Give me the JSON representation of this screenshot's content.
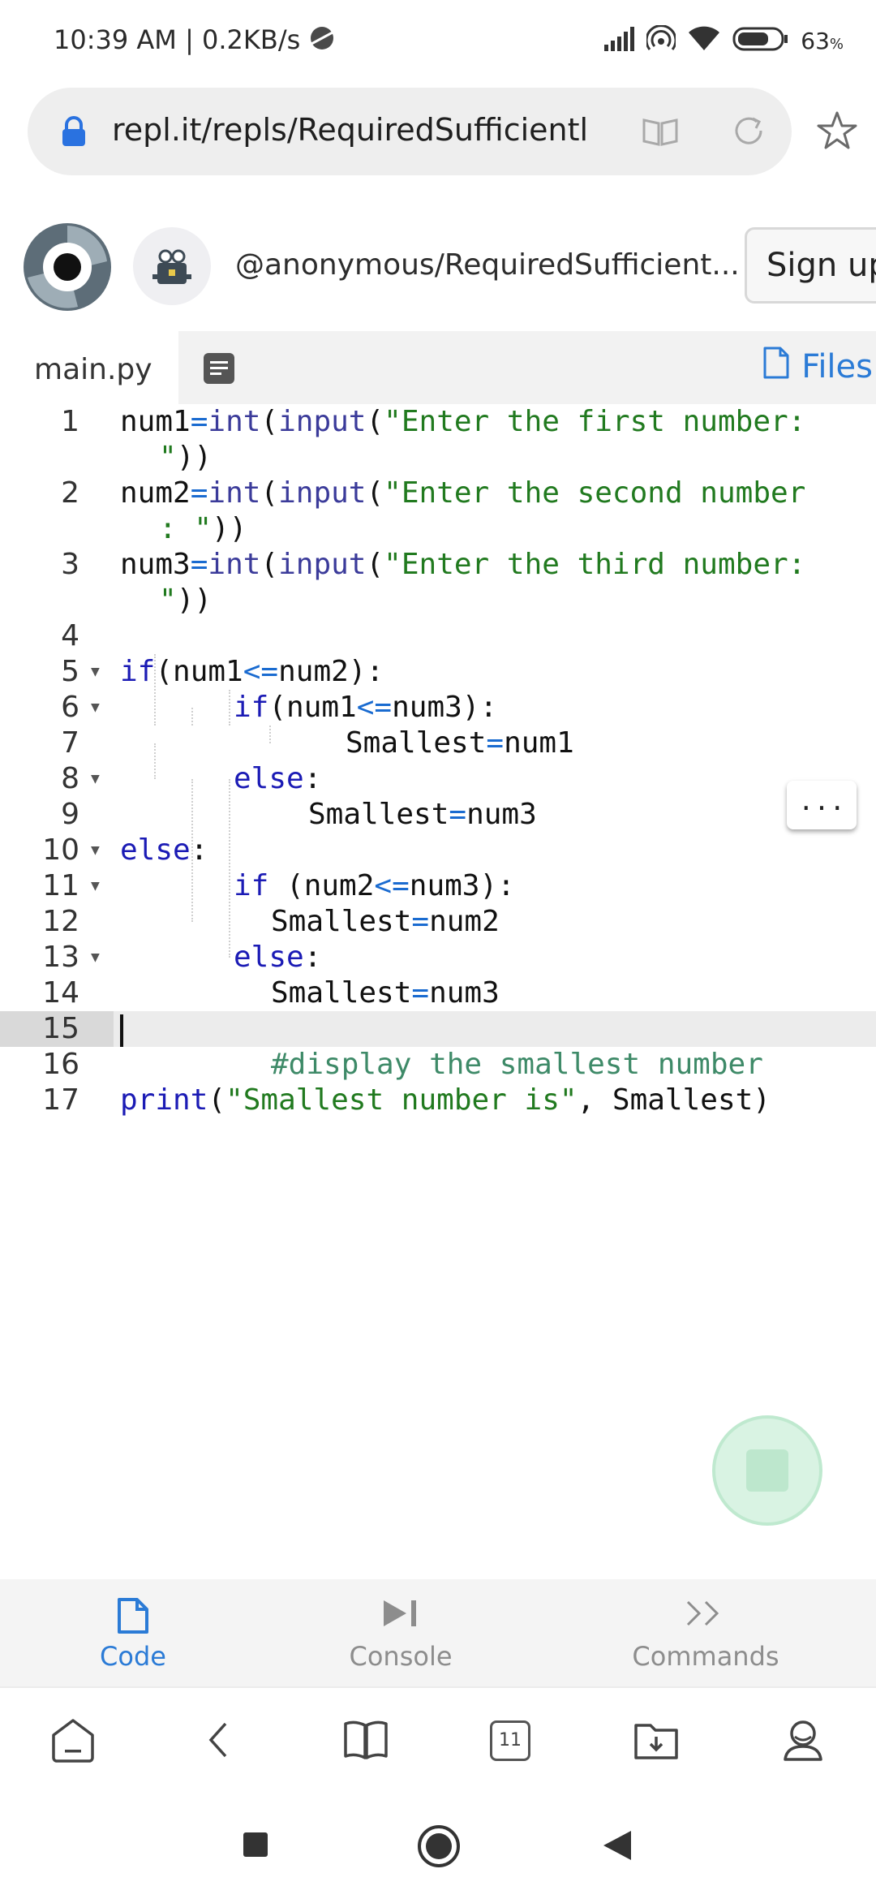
{
  "status": {
    "time_speed": "10:39 AM | 0.2KB/s",
    "battery": "63"
  },
  "browser": {
    "url": "repl.it/repls/RequiredSufficientl",
    "tabs_count": "11"
  },
  "repl": {
    "owner_name": "@anonymous/RequiredSufficient...",
    "signup_label": "Sign up",
    "file_tab": "main.py",
    "files_label": "Files",
    "more_label": "...",
    "active_line": "15"
  },
  "code": {
    "lines": [
      {
        "num": "1",
        "a": "num1",
        "b": "=",
        "c": "int",
        "d": "(",
        "e": "input",
        "f": "(",
        "g": "\"Enter the first number:",
        "cont": "\"))"
      },
      {
        "num": "2",
        "a": "num2",
        "b": "=",
        "c": "int",
        "d": "(",
        "e": "input",
        "f": "(",
        "g": "\"Enter the second number",
        "cont": ": \"))"
      },
      {
        "num": "3",
        "a": "num3",
        "b": "=",
        "c": "int",
        "d": "(",
        "e": "input",
        "f": "(",
        "g": "\"Enter the third number:",
        "cont": "\"))"
      },
      {
        "num": "4"
      },
      {
        "num": "5",
        "kw": "if",
        "rest1": "(num1",
        "op": "<=",
        "rest2": "num2):"
      },
      {
        "num": "6",
        "kw": "if",
        "rest1": "(num1",
        "op": "<=",
        "rest2": "num3):"
      },
      {
        "num": "7",
        "a": "Smallest",
        "op": "=",
        "b": "num1"
      },
      {
        "num": "8",
        "kw": "else",
        "rest": ":"
      },
      {
        "num": "9",
        "a": "Smallest",
        "op": "=",
        "b": "num3"
      },
      {
        "num": "10",
        "kw": "else",
        "rest": ":"
      },
      {
        "num": "11",
        "kw": "if",
        "rest1": " (num2",
        "op": "<=",
        "rest2": "num3):"
      },
      {
        "num": "12",
        "a": "Smallest",
        "op": "=",
        "b": "num2"
      },
      {
        "num": "13",
        "kw": "else",
        "rest": ":"
      },
      {
        "num": "14",
        "a": "Smallest",
        "op": "=",
        "b": "num3"
      },
      {
        "num": "15"
      },
      {
        "num": "16",
        "comment": "#display the smallest number"
      },
      {
        "num": "17",
        "kw": "print",
        "p1": "(",
        "str": "\"Smallest number is\"",
        "p2": ", Smallest)"
      }
    ]
  },
  "bottom_nav": {
    "code": "Code",
    "console": "Console",
    "commands": "Commands"
  },
  "colors": {
    "accent": "#2b7bd6",
    "keyword": "#1b1bb5",
    "string": "#217a1f",
    "comment": "#3e8a68"
  },
  "icons": [
    "lock-icon",
    "reader-mode-icon",
    "reload-icon",
    "star-icon",
    "replit-logo",
    "avatar",
    "document-icon",
    "file-icon",
    "play-icon",
    "chevrons-icon",
    "home-icon",
    "back-icon",
    "book-icon",
    "tabs-icon",
    "downloads-icon",
    "profile-icon",
    "recents-icon",
    "home-circle-icon",
    "back-triangle-icon"
  ]
}
